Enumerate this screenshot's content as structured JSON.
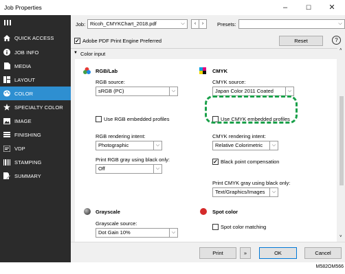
{
  "window": {
    "title": "Job Properties",
    "minimize": "–",
    "maximize": "☐",
    "close": "✕"
  },
  "sidebar": {
    "items": [
      {
        "label": "QUICK ACCESS",
        "icon": "home-icon"
      },
      {
        "label": "JOB INFO",
        "icon": "info-icon"
      },
      {
        "label": "MEDIA",
        "icon": "media-icon"
      },
      {
        "label": "LAYOUT",
        "icon": "layout-icon"
      },
      {
        "label": "COLOR",
        "icon": "palette-icon",
        "selected": true
      },
      {
        "label": "SPECIALTY COLOR",
        "icon": "star-icon"
      },
      {
        "label": "IMAGE",
        "icon": "image-icon"
      },
      {
        "label": "FINISHING",
        "icon": "finishing-icon"
      },
      {
        "label": "VDP",
        "icon": "vdp-icon"
      },
      {
        "label": "STAMPING",
        "icon": "stamping-icon"
      },
      {
        "label": "SUMMARY",
        "icon": "summary-icon"
      }
    ]
  },
  "toolbar": {
    "job_label": "Job:",
    "job_value": "Ricoh_CMYKChart_2018.pdf",
    "presets_label": "Presets:",
    "presets_value": "",
    "adobe_checkbox_label": "Adobe PDF Print Engine Preferred",
    "adobe_checked": true,
    "reset_label": "Reset",
    "help_label": "?"
  },
  "color_input": {
    "section_label": "Color input",
    "rgb": {
      "heading": "RGB/Lab",
      "source_label": "RGB source:",
      "source_value": "sRGB (PC)",
      "embedded_label": "Use RGB embedded profiles",
      "intent_label": "RGB rendering intent:",
      "intent_value": "Photographic",
      "gray_label": "Print RGB gray using black only:",
      "gray_value": "Off"
    },
    "cmyk": {
      "heading": "CMYK",
      "source_label": "CMYK source:",
      "source_value": "Japan Color 2011 Coated",
      "embedded_label": "Use CMYK embedded profiles",
      "intent_label": "CMYK rendering intent:",
      "intent_value": "Relative Colorimetric",
      "bpc_label": "Black point compensation",
      "bpc_checked": true,
      "gray_label": "Print CMYK gray using black only:",
      "gray_value": "Text/Graphics/Images"
    },
    "grayscale": {
      "heading": "Grayscale",
      "source_label": "Grayscale source:",
      "source_value": "Dot Gain 10%"
    },
    "spot": {
      "heading": "Spot color",
      "matching_label": "Spot color matching"
    }
  },
  "footer": {
    "print_label": "Print",
    "more_label": "»",
    "ok_label": "OK",
    "cancel_label": "Cancel"
  },
  "caption": "M582OM566",
  "colors": {
    "sidebar_bg": "#2b2b2b",
    "selected_bg": "#2e8fd1",
    "highlight": "#1aa04a",
    "spot_red": "#d42a2a"
  }
}
